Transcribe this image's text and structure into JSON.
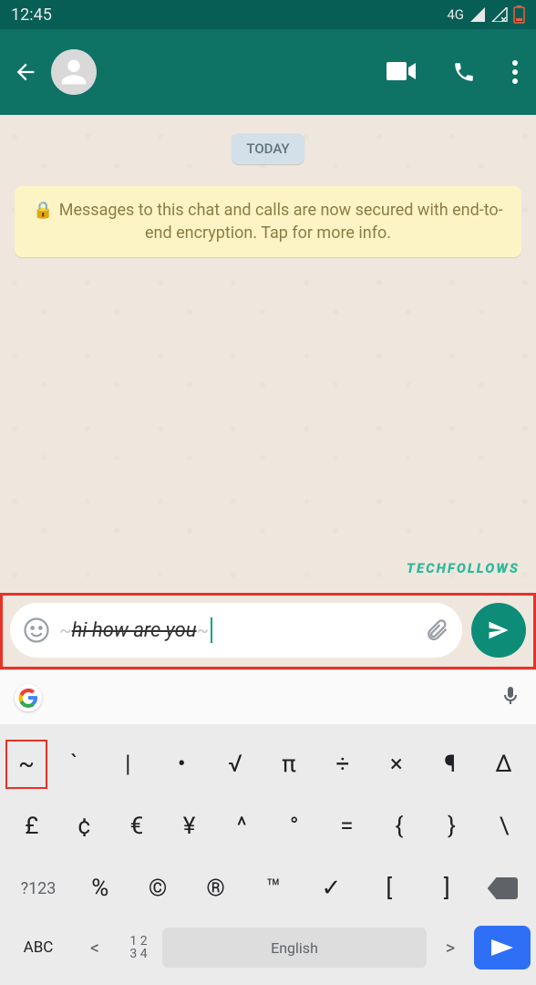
{
  "status_bar": {
    "time": "12:45",
    "network": "4G"
  },
  "chat": {
    "date_label": "TODAY",
    "encryption_message": "Messages to this chat and calls are now secured with end-to-end encryption. Tap for more info."
  },
  "watermark": "TECHFOLLOWS",
  "input": {
    "prefix_tilde": "~",
    "message_text": "hi how are you",
    "suffix_tilde": "~"
  },
  "keyboard": {
    "row1": [
      "~",
      "`",
      "|",
      "•",
      "√",
      "π",
      "÷",
      "×",
      "¶",
      "Δ"
    ],
    "row2": [
      "£",
      "¢",
      "€",
      "¥",
      "^",
      "°",
      "=",
      "{",
      "}",
      "\\"
    ],
    "row3_left": "?123",
    "row3_keys": [
      "%",
      "©",
      "®",
      "™",
      "✓",
      "[",
      "]"
    ],
    "row4": {
      "abc": "ABC",
      "left_angle": "<",
      "num_top": "1 2",
      "num_bottom": "3 4",
      "space": "English",
      "right_angle": ">"
    }
  }
}
